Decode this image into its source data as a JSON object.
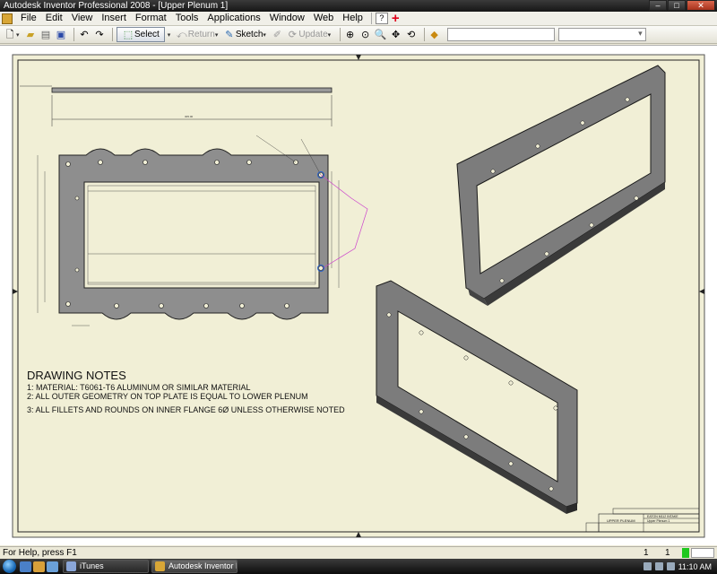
{
  "window": {
    "title": "Autodesk Inventor Professional 2008 - [Upper Plenum 1]",
    "controls": {
      "minimize": "–",
      "maximize": "□",
      "close": "✕"
    }
  },
  "menu": {
    "items": [
      "File",
      "Edit",
      "View",
      "Insert",
      "Format",
      "Tools",
      "Applications",
      "Window",
      "Web",
      "Help"
    ],
    "help_icon": "?",
    "add_icon": "+"
  },
  "toolbar": {
    "select_label": "Select",
    "return_label": "Return",
    "sketch_label": "Sketch",
    "update_label": "Update",
    "icons": [
      "new-icon",
      "open-icon",
      "save-icon",
      "undo-icon",
      "redo-icon",
      "select-icon",
      "return-icon",
      "sketch-icon",
      "update-icon",
      "zoom-all-icon",
      "zoom-window-icon",
      "zoom-icon",
      "pan-icon",
      "rotate-icon",
      "color-icon"
    ]
  },
  "drawing": {
    "notes": {
      "heading": "DRAWING NOTES",
      "lines": [
        "1: MATERIAL: T6061-T6 ALUMINUM OR SIMILAR MATERIAL",
        "2: ALL OUTER GEOMETRY ON TOP PLATE IS EQUAL TO LOWER PLENUM",
        "3: ALL FILLETS AND ROUNDS ON INNER FLANGE 6Ø UNLESS OTHERWISE NOTED"
      ]
    },
    "title_block": {
      "part_name": "UPPER PLENUM",
      "project": "EATON M112 INTAKE",
      "drawing_ref": "Upper Plenum 1"
    },
    "colors": {
      "sheet": "#f1efd6",
      "part_fill": "#8a8a8a",
      "part_dark": "#4a4a4a",
      "leader": "#cc44cc"
    }
  },
  "status": {
    "help_text": "For Help, press F1",
    "num1": "1",
    "num2": "1"
  },
  "taskbar": {
    "tasks": [
      "iTunes",
      "Autodesk Inventor P..."
    ],
    "clock": "11:10 AM"
  }
}
